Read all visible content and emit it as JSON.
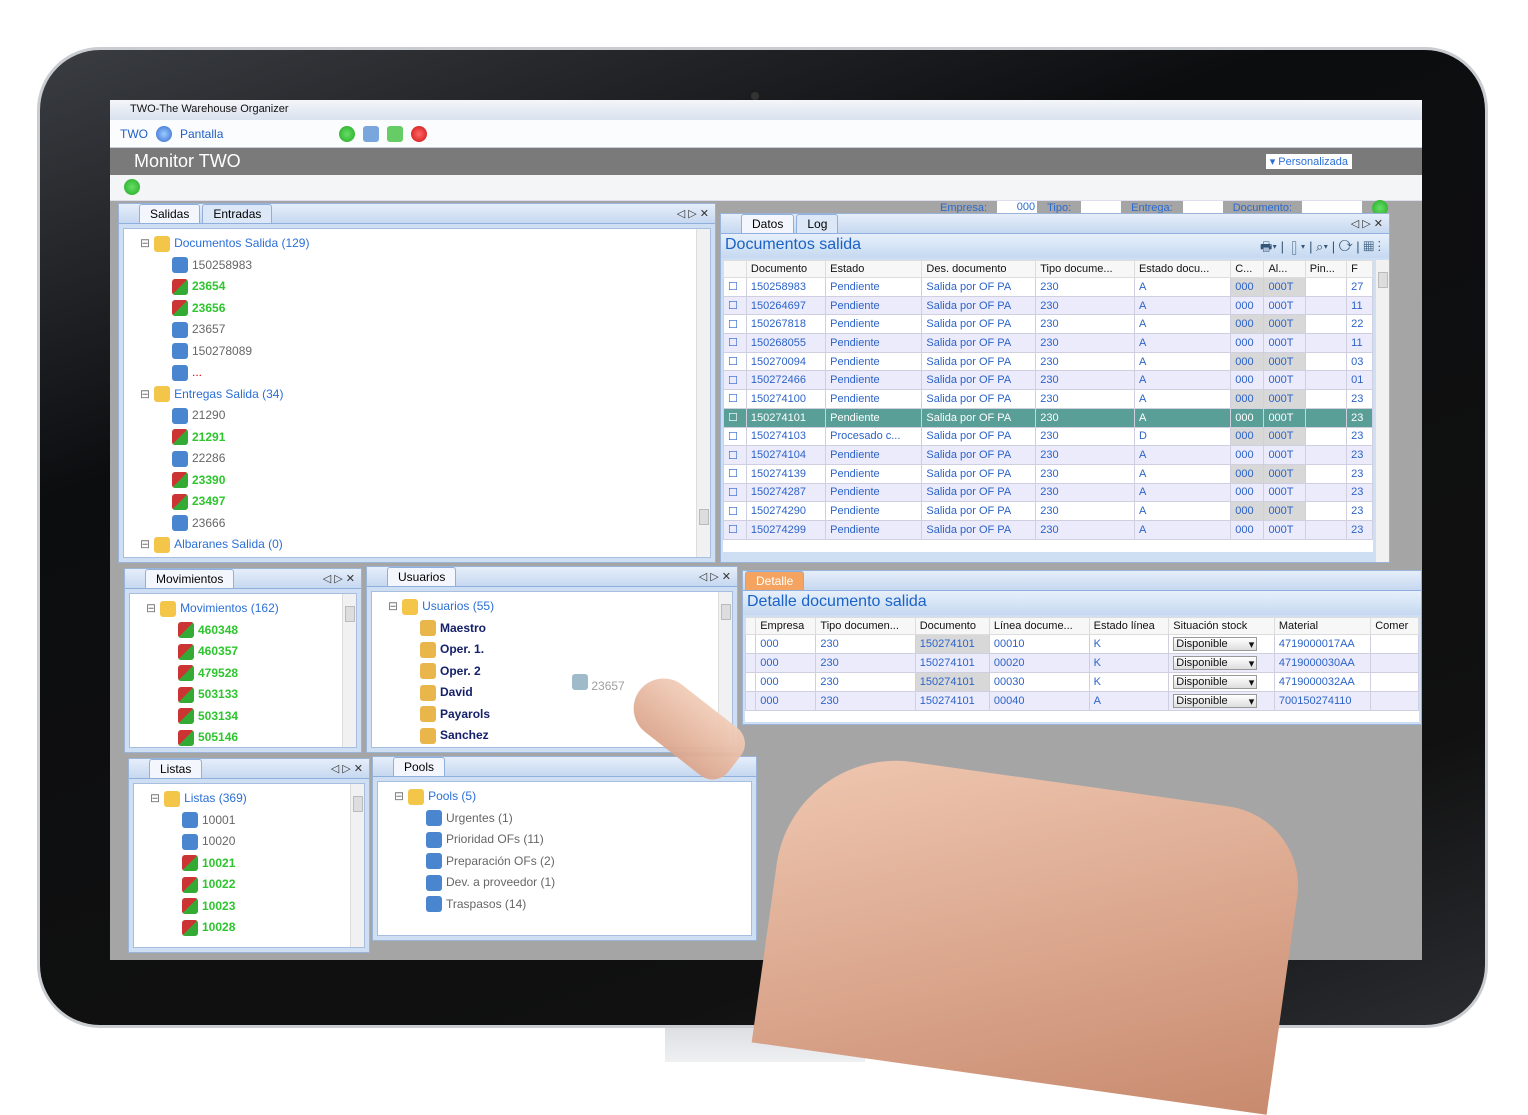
{
  "window": {
    "title": "TWO-The Warehouse Organizer"
  },
  "menu": {
    "two": "TWO",
    "pantalla": "Pantalla"
  },
  "header": {
    "title": "Monitor TWO",
    "layout_label": "Personalizada"
  },
  "filters": {
    "empresa_label": "Empresa:",
    "empresa_value": "000",
    "tipo_label": "Tipo:",
    "entrega_label": "Entrega:",
    "documento_label": "Documento:"
  },
  "left_tabs": [
    "Salidas",
    "Entradas"
  ],
  "salidas_tree": [
    {
      "label": "Documentos Salida (129)",
      "style": "root",
      "lvl": 0
    },
    {
      "label": "150258983",
      "style": "gray",
      "lvl": 1
    },
    {
      "label": "23654",
      "style": "green",
      "lvl": 1
    },
    {
      "label": "23656",
      "style": "green",
      "lvl": 1
    },
    {
      "label": "23657",
      "style": "gray",
      "lvl": 1
    },
    {
      "label": "150278089",
      "style": "gray",
      "lvl": 1
    },
    {
      "label": "...",
      "style": "red",
      "lvl": 1
    },
    {
      "label": "Entregas Salida (34)",
      "style": "root",
      "lvl": 0
    },
    {
      "label": "21290",
      "style": "gray",
      "lvl": 1
    },
    {
      "label": "21291",
      "style": "green",
      "lvl": 1
    },
    {
      "label": "22286",
      "style": "gray",
      "lvl": 1
    },
    {
      "label": "23390",
      "style": "green",
      "lvl": 1
    },
    {
      "label": "23497",
      "style": "green",
      "lvl": 1
    },
    {
      "label": "23666",
      "style": "gray",
      "lvl": 1
    },
    {
      "label": "Albaranes Salida (0)",
      "style": "root",
      "lvl": 0
    }
  ],
  "right_tabs": [
    "Datos",
    "Log"
  ],
  "documentos": {
    "title": "Documentos salida",
    "columns": [
      "Documento",
      "Estado",
      "Des. documento",
      "Tipo docume...",
      "Estado docu...",
      "C...",
      "Al...",
      "Pin...",
      "F"
    ],
    "rows": [
      [
        "150258983",
        "Pendiente",
        "Salida por OF PA",
        "230",
        "A",
        "000",
        "000T",
        "",
        "27"
      ],
      [
        "150264697",
        "Pendiente",
        "Salida por OF PA",
        "230",
        "A",
        "000",
        "000T",
        "",
        "11"
      ],
      [
        "150267818",
        "Pendiente",
        "Salida por OF PA",
        "230",
        "A",
        "000",
        "000T",
        "",
        "22"
      ],
      [
        "150268055",
        "Pendiente",
        "Salida por OF PA",
        "230",
        "A",
        "000",
        "000T",
        "",
        "11"
      ],
      [
        "150270094",
        "Pendiente",
        "Salida por OF PA",
        "230",
        "A",
        "000",
        "000T",
        "",
        "03"
      ],
      [
        "150272466",
        "Pendiente",
        "Salida por OF PA",
        "230",
        "A",
        "000",
        "000T",
        "",
        "01"
      ],
      [
        "150274100",
        "Pendiente",
        "Salida por OF PA",
        "230",
        "A",
        "000",
        "000T",
        "",
        "23"
      ],
      [
        "150274101",
        "Pendiente",
        "Salida por OF PA",
        "230",
        "A",
        "000",
        "000T",
        "",
        "23"
      ],
      [
        "150274103",
        "Procesado c...",
        "Salida por OF PA",
        "230",
        "D",
        "000",
        "000T",
        "",
        "23"
      ],
      [
        "150274104",
        "Pendiente",
        "Salida por OF PA",
        "230",
        "A",
        "000",
        "000T",
        "",
        "23"
      ],
      [
        "150274139",
        "Pendiente",
        "Salida por OF PA",
        "230",
        "A",
        "000",
        "000T",
        "",
        "23"
      ],
      [
        "150274287",
        "Pendiente",
        "Salida por OF PA",
        "230",
        "A",
        "000",
        "000T",
        "",
        "23"
      ],
      [
        "150274290",
        "Pendiente",
        "Salida por OF PA",
        "230",
        "A",
        "000",
        "000T",
        "",
        "23"
      ],
      [
        "150274299",
        "Pendiente",
        "Salida por OF PA",
        "230",
        "A",
        "000",
        "000T",
        "",
        "23"
      ]
    ],
    "selected_row": 7
  },
  "detalle": {
    "tab": "Detalle",
    "title": "Detalle documento salida",
    "columns": [
      "Empresa",
      "Tipo documen...",
      "Documento",
      "Línea docume...",
      "Estado línea",
      "Situación stock",
      "Material",
      "Comer"
    ],
    "rows": [
      [
        "000",
        "230",
        "150274101",
        "00010",
        "K",
        "Disponible",
        "4719000017AA",
        ""
      ],
      [
        "000",
        "230",
        "150274101",
        "00020",
        "K",
        "Disponible",
        "4719000030AA",
        ""
      ],
      [
        "000",
        "230",
        "150274101",
        "00030",
        "K",
        "Disponible",
        "4719000032AA",
        ""
      ],
      [
        "000",
        "230",
        "150274101",
        "00040",
        "A",
        "Disponible",
        "700150274110",
        ""
      ]
    ]
  },
  "movimientos": {
    "tab": "Movimientos",
    "items": [
      {
        "label": "Movimientos (162)",
        "style": "root",
        "lvl": 0
      },
      {
        "label": "460348",
        "style": "green",
        "lvl": 1
      },
      {
        "label": "460357",
        "style": "green",
        "lvl": 1
      },
      {
        "label": "479528",
        "style": "green",
        "lvl": 1
      },
      {
        "label": "503133",
        "style": "green",
        "lvl": 1
      },
      {
        "label": "503134",
        "style": "green",
        "lvl": 1
      },
      {
        "label": "505146",
        "style": "green",
        "lvl": 1
      }
    ]
  },
  "usuarios": {
    "tab": "Usuarios",
    "drag_item": "23657",
    "items": [
      {
        "label": "Usuarios (55)",
        "style": "root",
        "lvl": 0
      },
      {
        "label": "Maestro",
        "style": "navy",
        "lvl": 1
      },
      {
        "label": "Oper. 1.",
        "style": "navy",
        "lvl": 1
      },
      {
        "label": "Oper. 2",
        "style": "navy",
        "lvl": 1
      },
      {
        "label": "David",
        "style": "navy",
        "lvl": 1
      },
      {
        "label": "Payarols",
        "style": "navy",
        "lvl": 1
      },
      {
        "label": "Sanchez",
        "style": "navy",
        "lvl": 1
      }
    ]
  },
  "listas": {
    "tab": "Listas",
    "items": [
      {
        "label": "Listas (369)",
        "style": "root",
        "lvl": 0
      },
      {
        "label": "10001",
        "style": "gray",
        "lvl": 1
      },
      {
        "label": "10020",
        "style": "gray",
        "lvl": 1
      },
      {
        "label": "10021",
        "style": "green",
        "lvl": 1
      },
      {
        "label": "10022",
        "style": "green",
        "lvl": 1
      },
      {
        "label": "10023",
        "style": "green",
        "lvl": 1
      },
      {
        "label": "10028",
        "style": "green",
        "lvl": 1
      }
    ]
  },
  "pools": {
    "tab": "Pools",
    "items": [
      {
        "label": "Pools (5)",
        "style": "root",
        "lvl": 0
      },
      {
        "label": "Urgentes (1)",
        "style": "gray",
        "lvl": 1
      },
      {
        "label": "Prioridad OFs (11)",
        "style": "gray",
        "lvl": 1
      },
      {
        "label": "Preparación OFs (2)",
        "style": "gray",
        "lvl": 1
      },
      {
        "label": "Dev. a proveedor (1)",
        "style": "gray",
        "lvl": 1
      },
      {
        "label": "Traspasos (14)",
        "style": "gray",
        "lvl": 1
      }
    ]
  },
  "colors": {
    "accent": "#2b6fd6",
    "selected_row": "#5a9e98",
    "green_text": "#2ec52e"
  }
}
